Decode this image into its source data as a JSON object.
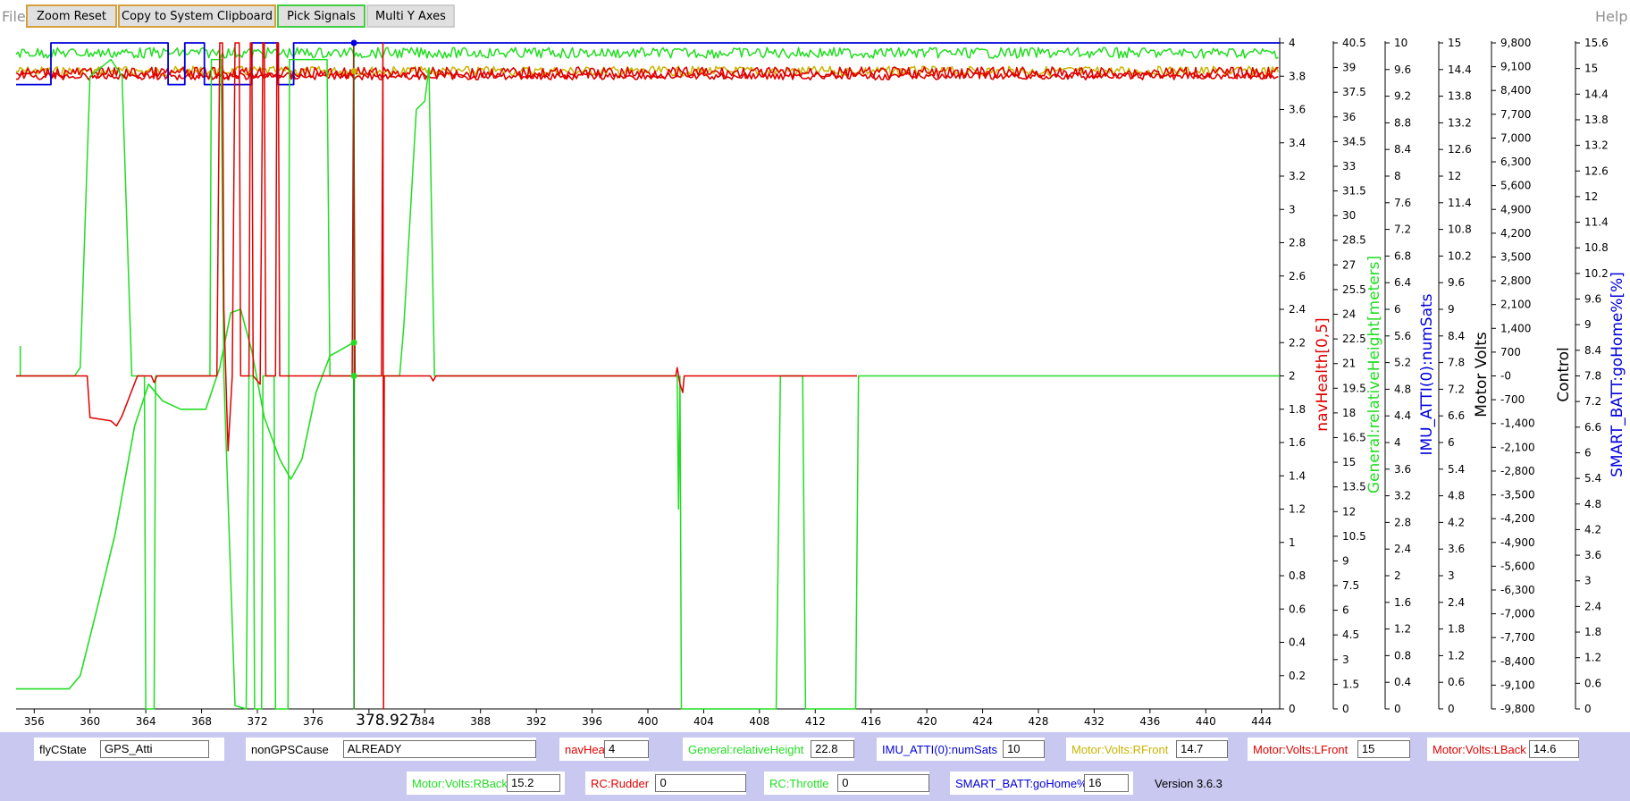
{
  "menu": {
    "file": "File",
    "help": "Help"
  },
  "toolbar": {
    "zoom_reset": "Zoom Reset",
    "copy_clipboard": "Copy to System Clipboard",
    "pick_signals": "Pick Signals",
    "multi_y_axes": "Multi Y Axes"
  },
  "chart_data": {
    "type": "line",
    "cursor_x_label": "378.927",
    "x": {
      "ticks": [
        356,
        360,
        364,
        368,
        372,
        376,
        380,
        384,
        388,
        392,
        396,
        400,
        404,
        408,
        412,
        416,
        420,
        424,
        428,
        432,
        436,
        440,
        444
      ],
      "tick_labels": [
        "356",
        "360",
        "364",
        "368",
        "372",
        "376",
        "",
        "384",
        "388",
        "392",
        "396",
        "400",
        "404",
        "408",
        "412",
        "416",
        "420",
        "424",
        "428",
        "432",
        "436",
        "440",
        "444"
      ]
    },
    "axes": [
      {
        "label": "",
        "color": "#000000",
        "ticks": [
          "4",
          "3.8",
          "3.6",
          "3.4",
          "3.2",
          "3",
          "2.8",
          "2.6",
          "2.4",
          "2.2",
          "2",
          "1.8",
          "1.6",
          "1.4",
          "1.2",
          "1",
          "0.8",
          "0.6",
          "0.4",
          "0.2",
          "0"
        ]
      },
      {
        "label": "navHealth[0,5]",
        "color": "#e00000",
        "ticks": [
          "40.5",
          "39",
          "37.5",
          "36",
          "34.5",
          "33",
          "31.5",
          "30",
          "28.5",
          "27",
          "25.5",
          "24",
          "22.5",
          "21",
          "19.5",
          "18",
          "16.5",
          "15",
          "13.5",
          "12",
          "10.5",
          "9",
          "7.5",
          "6",
          "4.5",
          "3",
          "1.5",
          "0"
        ]
      },
      {
        "label": "General:relativeHeight[meters]",
        "color": "#22dd22",
        "ticks": [
          "10",
          "9.6",
          "9.2",
          "8.8",
          "8.4",
          "8",
          "7.6",
          "7.2",
          "6.8",
          "6.4",
          "6",
          "5.6",
          "5.2",
          "4.8",
          "4.4",
          "4",
          "3.6",
          "3.2",
          "2.8",
          "2.4",
          "2",
          "1.6",
          "1.2",
          "0.8",
          "0.4",
          "0"
        ]
      },
      {
        "label": "IMU_ATTI(0):numSats",
        "color": "#0000dd",
        "ticks": [
          "15",
          "14.4",
          "13.8",
          "13.2",
          "12.6",
          "12",
          "11.4",
          "10.8",
          "10.2",
          "9.6",
          "9",
          "8.4",
          "7.8",
          "7.2",
          "6.6",
          "6",
          "5.4",
          "4.8",
          "4.2",
          "3.6",
          "3",
          "2.4",
          "1.8",
          "1.2",
          "0.6",
          "0"
        ]
      },
      {
        "label": "Motor Volts",
        "color": "#000000",
        "ticks": [
          "9,800",
          "9,100",
          "8,400",
          "7,700",
          "7,000",
          "6,300",
          "5,600",
          "4,900",
          "4,200",
          "3,500",
          "2,800",
          "2,100",
          "1,400",
          "700",
          "-0",
          "-700",
          "-1,400",
          "-2,100",
          "-2,800",
          "-3,500",
          "-4,200",
          "-4,900",
          "-5,600",
          "-6,300",
          "-7,000",
          "-7,700",
          "-8,400",
          "-9,100",
          "-9,800"
        ]
      },
      {
        "label": "Control",
        "color": "#000000",
        "ticks": []
      },
      {
        "label": "SMART_BATT:goHome%[%]",
        "color": "#0000dd",
        "ticks": [
          "15.6",
          "15",
          "14.4",
          "13.8",
          "13.2",
          "12.6",
          "12",
          "11.4",
          "10.8",
          "10.2",
          "9.6",
          "9",
          "8.4",
          "7.8",
          "7.2",
          "6.6",
          "6",
          "5.4",
          "4.8",
          "4.2",
          "3.6",
          "3",
          "2.4",
          "1.8",
          "1.2",
          "0.6",
          "0"
        ]
      }
    ],
    "series": [
      {
        "name": "navHealth",
        "color": "#e00000"
      },
      {
        "name": "General:relativeHeight",
        "color": "#22dd22"
      },
      {
        "name": "IMU_ATTI(0):numSats",
        "color": "#0000dd"
      },
      {
        "name": "Motor:Volts:RFront",
        "color": "#c8b400"
      }
    ]
  },
  "footer": {
    "fields": [
      {
        "label": "flyCState",
        "value": "GPS_Atti",
        "color": "#000000"
      },
      {
        "label": "nonGPSCause",
        "value": "ALREADY",
        "color": "#000000"
      },
      {
        "label": "navHealth",
        "value": "4",
        "color": "#e00000"
      },
      {
        "label": "General:relativeHeight",
        "value": "22.8",
        "color": "#22dd22"
      },
      {
        "label": "IMU_ATTI(0):numSats",
        "value": "10",
        "color": "#0000dd"
      },
      {
        "label": "Motor:Volts:RFront",
        "value": "14.7",
        "color": "#c8b400"
      },
      {
        "label": "Motor:Volts:LFront",
        "value": "15",
        "color": "#e00000"
      },
      {
        "label": "Motor:Volts:LBack",
        "value": "14.6",
        "color": "#e00000"
      },
      {
        "label": "Motor:Volts:RBack",
        "value": "15.2",
        "color": "#22dd22"
      },
      {
        "label": "RC:Rudder",
        "value": "0",
        "color": "#e00000"
      },
      {
        "label": "RC:Throttle",
        "value": "0",
        "color": "#22dd22"
      },
      {
        "label": "SMART_BATT:goHome%",
        "value": "16",
        "color": "#0000dd"
      }
    ],
    "version": "Version 3.6.3"
  }
}
